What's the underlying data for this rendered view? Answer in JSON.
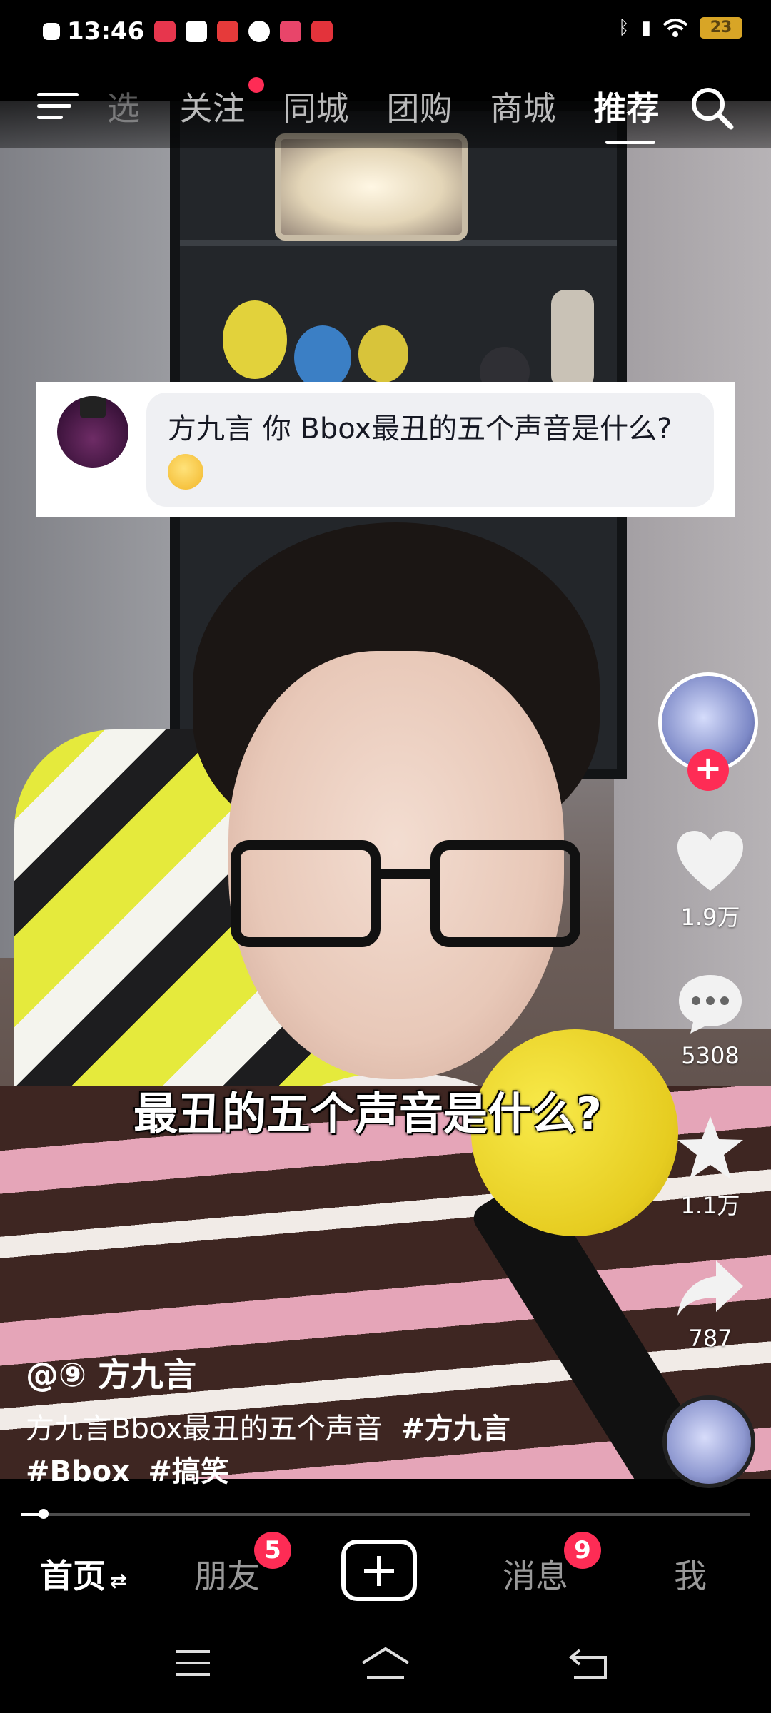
{
  "status_bar": {
    "time": "13:46",
    "notification_icons": [
      {
        "name": "app-icon-1",
        "color": "#e7364d"
      },
      {
        "name": "app-icon-2",
        "color": "#ffffff"
      },
      {
        "name": "app-icon-3",
        "color": "#e63a3a"
      },
      {
        "name": "app-icon-4",
        "color": "#ffffff"
      },
      {
        "name": "app-icon-5",
        "color": "#e8456a"
      },
      {
        "name": "app-icon-6",
        "color": "#e3333b"
      }
    ],
    "battery": "23"
  },
  "top_nav": {
    "tabs": [
      {
        "label": "选",
        "active": false
      },
      {
        "label": "关注",
        "active": false,
        "dot": true
      },
      {
        "label": "同城",
        "active": false
      },
      {
        "label": "团购",
        "active": false
      },
      {
        "label": "商城",
        "active": false
      },
      {
        "label": "推荐",
        "active": true
      }
    ]
  },
  "question_card": {
    "text": "方九言 你 Bbox最丑的五个声音是什么?"
  },
  "subtitle": "最丑的五个声音是什么?",
  "actions": {
    "likes": "1.9万",
    "comments": "5308",
    "favorites": "1.1万",
    "shares": "787"
  },
  "caption": {
    "author": "@⑨  方九言",
    "description": "方九言Bbox最丑的五个声音",
    "hashtags": [
      "#方九言",
      "#Bbox",
      "#搞笑"
    ]
  },
  "progress": 0.03,
  "bottom_nav": {
    "home": "首页",
    "friends": "朋友",
    "friends_badge": "5",
    "messages": "消息",
    "messages_badge": "9",
    "me": "我"
  },
  "colors": {
    "accent": "#fe2c55"
  }
}
